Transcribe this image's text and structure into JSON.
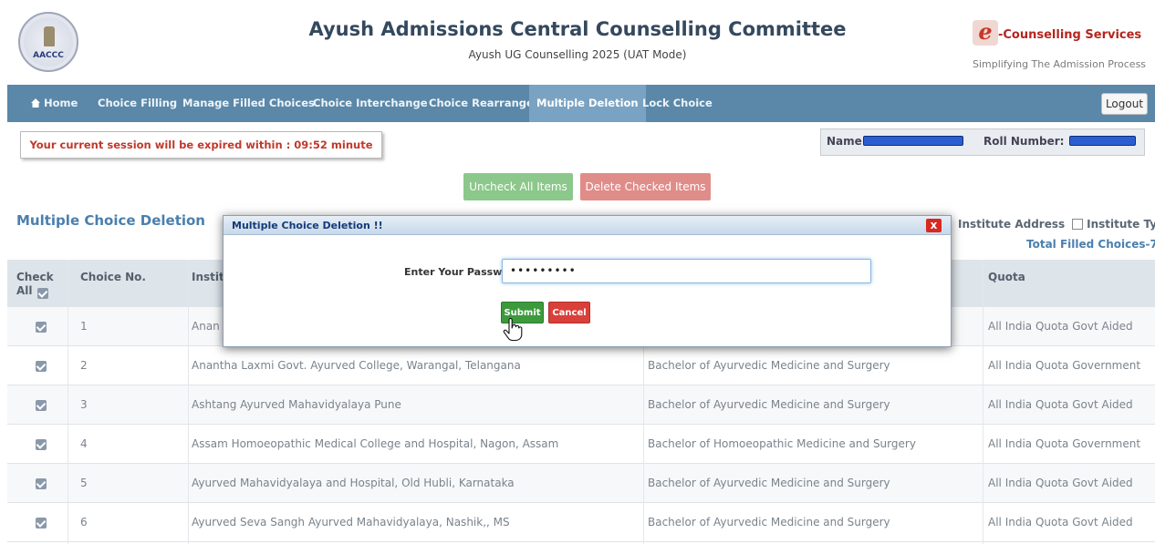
{
  "header": {
    "title": "Ayush Admissions Central Counselling Committee",
    "subtitle": "Ayush UG Counselling 2025 (UAT Mode)",
    "left_logo_text": "AACCC",
    "right_logo_name": "-Counselling Services",
    "right_logo_tagline": "Simplifying The Admission Process"
  },
  "nav": {
    "items": [
      {
        "label": "Home",
        "icon": "home-icon",
        "active": false
      },
      {
        "label": "Choice Filling",
        "active": false
      },
      {
        "label": "Manage Filled Choices",
        "active": false
      },
      {
        "label": "Choice Interchange",
        "active": false
      },
      {
        "label": "Choice Rearrange",
        "active": false
      },
      {
        "label": "Multiple Deletion",
        "active": true
      },
      {
        "label": "Lock Choice",
        "active": false
      }
    ],
    "logout": "Logout",
    "bg_color": "#5b87a8"
  },
  "session_text": "Your current session will be expired within : 09:52 minute",
  "user_bar": {
    "name_label": "Name:",
    "roll_label": "Roll Number:"
  },
  "actions": {
    "uncheck_all": "Uncheck All Items",
    "delete_checked": "Delete Checked Items"
  },
  "section_title": "Multiple Choice Deletion",
  "filters": {
    "institute_address": "Institute Address",
    "institute_type": "Institute Type"
  },
  "total_filled": "Total Filled Choices-7",
  "table": {
    "headers": {
      "check_all": "Check All",
      "choice_no": "Choice No.",
      "institute": "Instit",
      "quota": "Quota"
    },
    "rows": [
      {
        "no": "1",
        "institute": "Anan",
        "course": "",
        "quota": "All India Quota Govt Aided"
      },
      {
        "no": "2",
        "institute": "Anantha Laxmi Govt. Ayurved College, Warangal, Telangana",
        "course": "Bachelor of Ayurvedic Medicine and Surgery",
        "quota": "All India Quota Government"
      },
      {
        "no": "3",
        "institute": "Ashtang Ayurved Mahavidyalaya Pune",
        "course": "Bachelor of Ayurvedic Medicine and Surgery",
        "quota": "All India Quota Govt Aided"
      },
      {
        "no": "4",
        "institute": "Assam Homoeopathic Medical College and Hospital, Nagon, Assam",
        "course": "Bachelor of Homoeopathic Medicine and Surgery",
        "quota": "All India Quota Government"
      },
      {
        "no": "5",
        "institute": "Ayurved Mahavidyalaya and Hospital, Old Hubli, Karnataka",
        "course": "Bachelor of Ayurvedic Medicine and Surgery",
        "quota": "All India Quota Govt Aided"
      },
      {
        "no": "6",
        "institute": "Ayurved Seva Sangh Ayurved Mahavidyalaya, Nashik,, MS",
        "course": "Bachelor of Ayurvedic Medicine and Surgery",
        "quota": "All India Quota Govt Aided"
      }
    ]
  },
  "modal": {
    "title": "Multiple Choice Deletion !!",
    "close": "x",
    "password_label": "Enter Your Password :",
    "password_value": "•••••••••",
    "submit": "Submit",
    "cancel": "Cancel"
  }
}
